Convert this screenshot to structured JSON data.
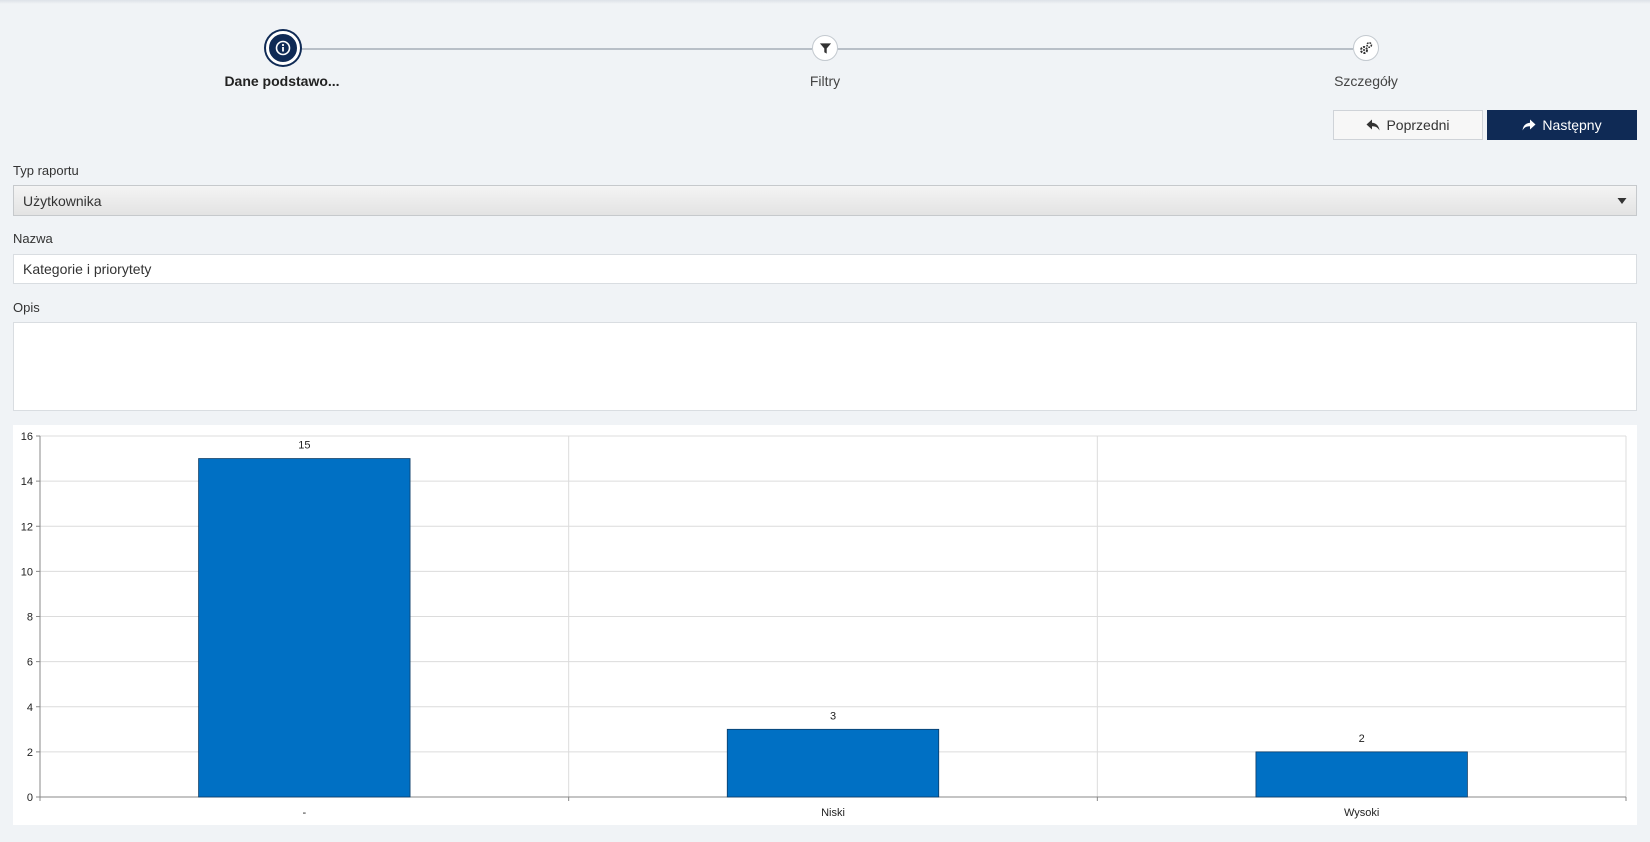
{
  "stepper": {
    "steps": [
      {
        "label": "Dane podstawo...",
        "icon": "info-icon",
        "active": true
      },
      {
        "label": "Filtry",
        "icon": "filter-icon",
        "active": false
      },
      {
        "label": "Szczegóły",
        "icon": "gears-icon",
        "active": false
      }
    ]
  },
  "nav": {
    "prev_label": "Poprzedni",
    "next_label": "Następny"
  },
  "form": {
    "report_type_label": "Typ raportu",
    "report_type_value": "Użytkownika",
    "name_label": "Nazwa",
    "name_value": "Kategorie i priorytety",
    "description_label": "Opis",
    "description_value": ""
  },
  "colors": {
    "accent": "#0f2a55",
    "bar": "#0070c4"
  },
  "chart_data": {
    "type": "bar",
    "categories": [
      "-",
      "Niski",
      "Wysoki"
    ],
    "values": [
      15,
      3,
      2
    ],
    "ylim": [
      0,
      16
    ],
    "yticks": [
      0,
      2,
      4,
      6,
      8,
      10,
      12,
      14,
      16
    ],
    "grid": true,
    "data_labels": true
  }
}
